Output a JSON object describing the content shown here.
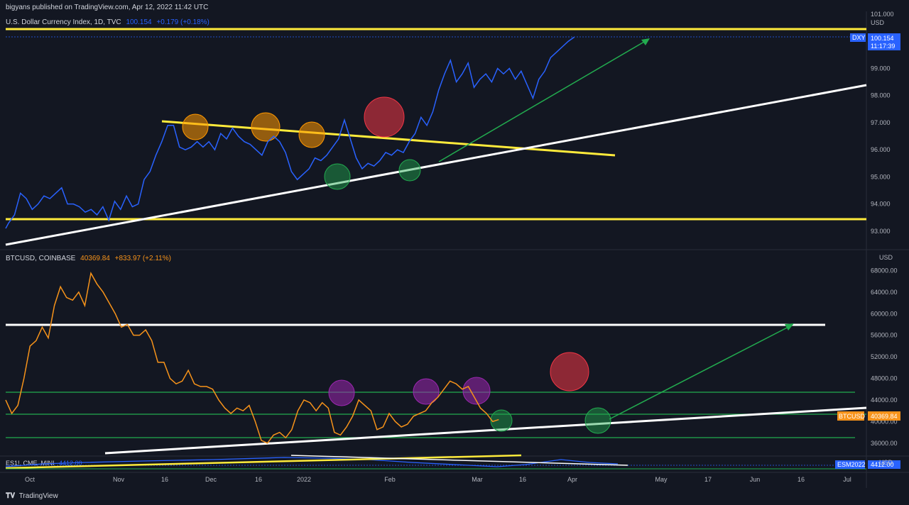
{
  "header": {
    "publish_text": "bigyans published on TradingView.com, Apr 12, 2022 11:42 UTC"
  },
  "pane_dxy": {
    "symbol": "U.S. Dollar Currency Index, 1D, TVC",
    "last": "100.154",
    "change": "+0.179 (+0.18%)",
    "currency": "USD",
    "badge_symbol": "DXY",
    "badge_price": "100.154",
    "badge_time": "11:17:39",
    "color": "#2962ff"
  },
  "pane_btc": {
    "symbol": "BTCUSD, COINBASE",
    "last": "40369.84",
    "change": "+833.97 (+2.11%)",
    "currency": "USD",
    "badge_symbol": "BTCUSD",
    "badge_price": "40369.84",
    "color": "#f7931a"
  },
  "pane_es": {
    "symbol": "ES1!, CME_MINI",
    "last": "4412.00",
    "badge_symbol": "ESM2022",
    "badge_price": "4412.00",
    "currency": "USD"
  },
  "footer": {
    "brand": "TradingView"
  },
  "chart_data": [
    {
      "type": "line",
      "name": "DXY",
      "ylim": [
        92.5,
        101.0
      ],
      "y_ticks": [
        "101.000",
        "99.000",
        "98.000",
        "97.000",
        "96.000",
        "95.000",
        "94.000",
        "93.000"
      ],
      "x": [
        0,
        1,
        3,
        5,
        7,
        9,
        11,
        13,
        15,
        17,
        19,
        21,
        23,
        25,
        27,
        29,
        31,
        33,
        35,
        37,
        39,
        41,
        43,
        45,
        47,
        49,
        51,
        53,
        55,
        57,
        59,
        61,
        63,
        65,
        67,
        69,
        71,
        73,
        75,
        77,
        79,
        81,
        83,
        85,
        87,
        89,
        91,
        93,
        95,
        97,
        99,
        101,
        103,
        105,
        107,
        109,
        111,
        113,
        115,
        117,
        119,
        121,
        123,
        125,
        127,
        129,
        131,
        133,
        135,
        137,
        139,
        141,
        143,
        145,
        147,
        149,
        151,
        153,
        155,
        157,
        159,
        161,
        163,
        165,
        167,
        169,
        171,
        173,
        175,
        177,
        179,
        181,
        183,
        185,
        187,
        189,
        191,
        193,
        195,
        197,
        199,
        201,
        203
      ],
      "values": [
        93.1,
        93.3,
        93.6,
        94.4,
        94.2,
        93.8,
        94.0,
        94.3,
        94.2,
        94.4,
        94.6,
        94.0,
        94.0,
        93.9,
        93.7,
        93.8,
        93.6,
        93.9,
        93.4,
        94.1,
        93.8,
        94.3,
        93.9,
        94.0,
        94.9,
        95.2,
        95.8,
        96.3,
        96.9,
        96.9,
        96.1,
        96.0,
        96.1,
        96.3,
        96.1,
        96.3,
        96.0,
        96.6,
        96.4,
        96.8,
        96.5,
        96.3,
        96.2,
        96.0,
        95.8,
        96.3,
        96.5,
        96.3,
        95.9,
        95.2,
        94.9,
        95.1,
        95.3,
        95.7,
        95.6,
        95.8,
        96.1,
        96.4,
        97.1,
        96.4,
        95.7,
        95.3,
        95.5,
        95.4,
        95.6,
        95.9,
        95.8,
        96.0,
        95.9,
        96.3,
        96.6,
        97.2,
        96.9,
        97.4,
        98.2,
        98.8,
        99.3,
        98.5,
        98.8,
        99.2,
        98.3,
        98.6,
        98.8,
        98.5,
        99.0,
        98.8,
        99.0,
        98.6,
        98.9,
        98.4,
        97.9,
        98.6,
        98.9,
        99.4,
        99.6,
        99.8,
        100.0,
        100.154
      ]
    },
    {
      "type": "line",
      "name": "BTCUSD",
      "ylim": [
        34000,
        69500
      ],
      "y_ticks": [
        "68000.00",
        "64000.00",
        "60000.00",
        "56000.00",
        "52000.00",
        "48000.00",
        "44000.00",
        "40000.00",
        "36000.00"
      ],
      "x": [
        0,
        2,
        4,
        6,
        8,
        10,
        12,
        14,
        16,
        18,
        20,
        22,
        24,
        26,
        28,
        30,
        32,
        34,
        36,
        38,
        40,
        42,
        44,
        46,
        48,
        50,
        52,
        54,
        56,
        58,
        60,
        62,
        64,
        66,
        68,
        70,
        72,
        74,
        76,
        78,
        80,
        82,
        84,
        86,
        88,
        90,
        92,
        94,
        96,
        98,
        100,
        102,
        104,
        106,
        108,
        110,
        112,
        114,
        116,
        118,
        120,
        122,
        124,
        126,
        128,
        130,
        132,
        134,
        136,
        138,
        140,
        142,
        144,
        146,
        148,
        150,
        152,
        154,
        156,
        158,
        160,
        162,
        164,
        166,
        168,
        170,
        172,
        174,
        176,
        178,
        180,
        182,
        184,
        186,
        188,
        190,
        192,
        194,
        196
      ],
      "values": [
        44000,
        41500,
        43000,
        48000,
        54000,
        55000,
        57500,
        55500,
        61500,
        65000,
        63000,
        62500,
        64000,
        61500,
        67500,
        65500,
        64000,
        62000,
        60000,
        57500,
        58000,
        56000,
        56000,
        57000,
        55000,
        51000,
        51000,
        48000,
        47000,
        47500,
        49500,
        47000,
        46500,
        46500,
        46000,
        44000,
        42500,
        41500,
        42500,
        42000,
        43000,
        40000,
        36500,
        36000,
        37500,
        38000,
        37000,
        38500,
        42000,
        44000,
        43500,
        42000,
        43500,
        42500,
        38000,
        37500,
        39000,
        41000,
        44000,
        43000,
        42000,
        38500,
        39000,
        41500,
        40000,
        39000,
        39500,
        41000,
        41500,
        42000,
        43500,
        44500,
        46000,
        47500,
        47000,
        46000,
        46500,
        44500,
        42500,
        41500,
        40000,
        40369.84
      ]
    },
    {
      "type": "line",
      "name": "ES1!",
      "values": [
        4412
      ]
    }
  ],
  "x_axis_labels": [
    "Oct",
    "Nov",
    "16",
    "Dec",
    "16",
    "2022",
    "Feb",
    "Mar",
    "16",
    "Apr",
    "May",
    "17",
    "Jun",
    "16",
    "Jul"
  ]
}
